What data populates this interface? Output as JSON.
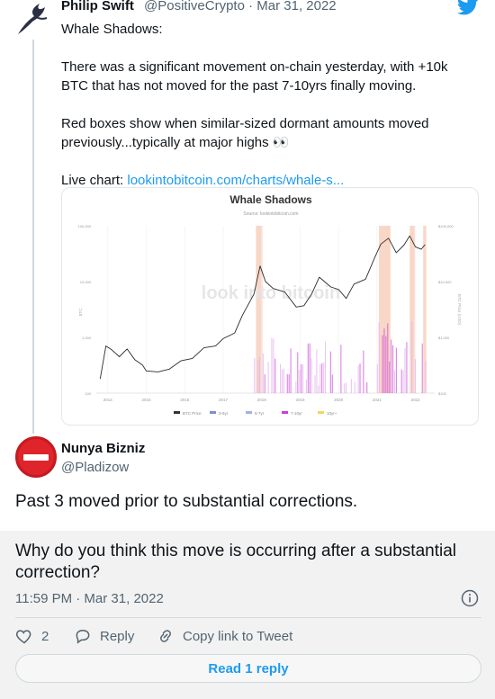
{
  "quoted_tweet": {
    "name": "Philip Swift",
    "handle_date": "@PositiveCrypto · Mar 31, 2022",
    "lines": [
      "Whale Shadows:",
      "",
      "There was a significant movement on-chain yesterday, with +10k BTC that has not moved for the past 7-10yrs finally moving.",
      "",
      "Red boxes show when similar-sized dormant amounts moved previously...typically at major highs 👀"
    ],
    "link_label": "Live chart: ",
    "link_text": "lookintobitcoin.com/charts/whale-s..."
  },
  "chart_data": {
    "type": "line",
    "title": "Whale Shadows",
    "subtitle": "Source: lookintobitcoin.com",
    "watermark": "look into bitcoin",
    "ylabel_left": "BTC",
    "ylabel_right": "BTC Price (USD)",
    "x_ticks": [
      "2014",
      "2015",
      "2016",
      "2017",
      "2018",
      "2019",
      "2020",
      "2021",
      "2022"
    ],
    "y_left_ticks": [
      "100,000",
      "10,000",
      "1,000",
      "100"
    ],
    "y_right_ticks": [
      "$100,000",
      "$10,000",
      "$1,000",
      "$100"
    ],
    "legend": [
      {
        "label": "BTC Price",
        "color": "#333333"
      },
      {
        "label": "3-5yr",
        "color": "#7b8fd8"
      },
      {
        "label": "5-7yr",
        "color": "#9fb3e8"
      },
      {
        "label": "7-10yr",
        "color": "#c93fd8"
      },
      {
        "label": "10yr+",
        "color": "#f2d65a"
      }
    ],
    "price_series": [
      [
        2013.8,
        180
      ],
      [
        2013.95,
        700
      ],
      [
        2014.1,
        600
      ],
      [
        2014.3,
        450
      ],
      [
        2014.5,
        620
      ],
      [
        2014.7,
        400
      ],
      [
        2014.9,
        320
      ],
      [
        2015.0,
        250
      ],
      [
        2015.3,
        240
      ],
      [
        2015.6,
        270
      ],
      [
        2015.9,
        380
      ],
      [
        2016.2,
        420
      ],
      [
        2016.5,
        650
      ],
      [
        2016.8,
        700
      ],
      [
        2017.0,
        950
      ],
      [
        2017.3,
        1200
      ],
      [
        2017.5,
        2500
      ],
      [
        2017.8,
        6000
      ],
      [
        2017.96,
        19000
      ],
      [
        2018.1,
        10000
      ],
      [
        2018.3,
        7500
      ],
      [
        2018.6,
        6500
      ],
      [
        2018.9,
        3500
      ],
      [
        2019.1,
        3700
      ],
      [
        2019.3,
        6000
      ],
      [
        2019.5,
        12000
      ],
      [
        2019.8,
        8000
      ],
      [
        2020.0,
        7200
      ],
      [
        2020.2,
        5000
      ],
      [
        2020.4,
        9000
      ],
      [
        2020.7,
        11000
      ],
      [
        2020.95,
        28000
      ],
      [
        2021.1,
        47000
      ],
      [
        2021.3,
        60000
      ],
      [
        2021.5,
        33000
      ],
      [
        2021.7,
        45000
      ],
      [
        2021.85,
        66000
      ],
      [
        2022.0,
        42000
      ],
      [
        2022.15,
        38000
      ],
      [
        2022.25,
        46000
      ]
    ],
    "highlight_bands": [
      [
        2017.85,
        2018.02
      ],
      [
        2021.05,
        2021.35
      ],
      [
        2021.85,
        2021.98
      ],
      [
        2022.2,
        2022.28
      ]
    ],
    "colors": {
      "bands": "#f7c9b4",
      "bars": "#e3b6ef",
      "bars_strong": "#c93fd8",
      "line": "#2b2b2b"
    }
  },
  "reply": {
    "name": "Nunya Bizniz",
    "handle": "@Pladizow",
    "text": "Past 3 moved prior to substantial corrections."
  },
  "focused_tweet": {
    "text": "Why do you think this move is occurring after a substantial correction?",
    "time": "11:59 PM · Mar 31, 2022",
    "like_count": "2",
    "reply_label": "Reply",
    "copy_label": "Copy link to Tweet",
    "read_reply_label": "Read 1 reply"
  },
  "icons": [
    "bird-avatar-icon",
    "twitter-logo-icon",
    "no-entry-avatar-icon",
    "info-icon",
    "heart-icon",
    "reply-icon",
    "link-icon"
  ],
  "colors": {
    "link": "#1d9bf0",
    "muted": "#536471",
    "avatar_red": "#e0242b"
  }
}
